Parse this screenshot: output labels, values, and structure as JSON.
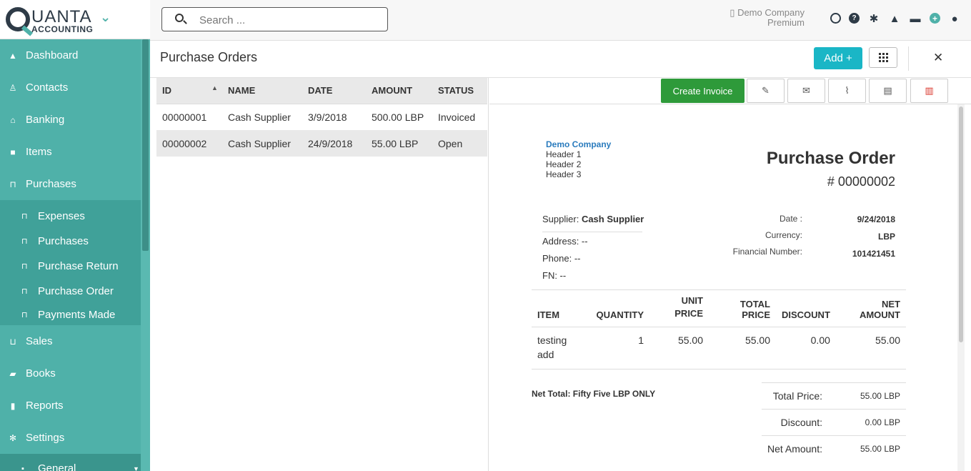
{
  "brand": {
    "name": "UANTA",
    "sub": "ACCOUNTING"
  },
  "sidebar": {
    "items": [
      {
        "label": "Dashboard",
        "icon": "chart-area-icon"
      },
      {
        "label": "Contacts",
        "icon": "contacts-icon"
      },
      {
        "label": "Banking",
        "icon": "bank-icon"
      },
      {
        "label": "Items",
        "icon": "items-icon"
      },
      {
        "label": "Purchases",
        "icon": "basket-icon"
      }
    ],
    "purchases_sub": [
      {
        "label": "Expenses"
      },
      {
        "label": "Purchases"
      },
      {
        "label": "Purchase Return"
      },
      {
        "label": "Purchase Order"
      },
      {
        "label": "Payments Made"
      }
    ],
    "items2": [
      {
        "label": "Sales",
        "icon": "cart-icon"
      },
      {
        "label": "Books",
        "icon": "book-icon"
      },
      {
        "label": "Reports",
        "icon": "bar-chart-icon"
      },
      {
        "label": "Settings",
        "icon": "gear-icon"
      }
    ],
    "settings_sub": [
      {
        "label": "General"
      }
    ]
  },
  "topbar": {
    "search_placeholder": "Search ...",
    "company": "Demo Company",
    "plan": "Premium"
  },
  "page": {
    "title": "Purchase Orders",
    "add_label": "Add +"
  },
  "list": {
    "columns": [
      "ID",
      "NAME",
      "DATE",
      "AMOUNT",
      "STATUS"
    ],
    "rows": [
      {
        "id": "00000001",
        "name": "Cash Supplier",
        "date": "3/9/2018",
        "amount": "500.00 LBP",
        "status": "Invoiced"
      },
      {
        "id": "00000002",
        "name": "Cash Supplier",
        "date": "24/9/2018",
        "amount": "55.00 LBP",
        "status": "Open"
      }
    ]
  },
  "toolbar": {
    "create_invoice": "Create Invoice"
  },
  "doc": {
    "company": "Demo Company",
    "headers": [
      "Header 1",
      "Header 2",
      "Header 3"
    ],
    "title": "Purchase Order",
    "number": "# 00000002",
    "supplier_label": "Supplier:",
    "supplier": "Cash Supplier",
    "address": "Address: --",
    "phone": "Phone: --",
    "fn": "FN: --",
    "meta": [
      {
        "k": "Date :",
        "v": "9/24/2018"
      },
      {
        "k": "Currency:",
        "v": "LBP"
      },
      {
        "k": "Financial Number:",
        "v": "101421451"
      }
    ],
    "columns": {
      "item": "ITEM",
      "quantity": "QUANTITY",
      "unit_price_1": "UNIT",
      "unit_price_2": "PRICE",
      "total_price": "TOTAL PRICE",
      "discount": "DISCOUNT",
      "net_amount": "NET AMOUNT"
    },
    "lines": [
      {
        "item_1": "testing",
        "item_2": "add",
        "quantity": "1",
        "unit_price": "55.00",
        "total_price": "55.00",
        "discount": "0.00",
        "net_amount": "55.00"
      }
    ],
    "net_words": "Net Total: Fifty Five LBP ONLY",
    "totals": [
      {
        "k": "Total Price:",
        "v": "55.00 LBP"
      },
      {
        "k": "Discount:",
        "v": "0.00 LBP"
      },
      {
        "k": "Net Amount:",
        "v": "55.00 LBP"
      }
    ]
  },
  "colors": {
    "sidebar": "#4fb1a9",
    "add_button": "#1ab6c6",
    "create_invoice": "#2e9a3a",
    "delete": "#d9352b",
    "link": "#2a7bbd"
  }
}
